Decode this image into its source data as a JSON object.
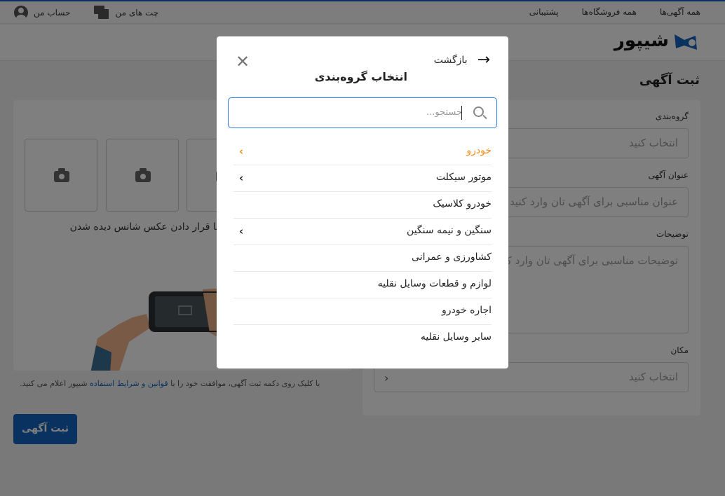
{
  "topbar": {
    "nav_right": [
      "همه آگهی‌ها",
      "همه فروشگاه‌ها",
      "پشتیبانی"
    ],
    "account_label": "حساب من",
    "chats_label": "چت های من"
  },
  "header": {
    "logo_text": "شیپور",
    "brand_color": "#1565c0"
  },
  "page": {
    "title": "ثبت آگهی"
  },
  "form": {
    "category_label": "گروه‌بندی",
    "category_placeholder": "انتخاب کنید",
    "ad_title_label": "عنوان آگهی",
    "ad_title_placeholder": "عنوان مناسبی برای آگهی تان وارد کنید",
    "description_label": "توضیحات",
    "description_placeholder": "توضیحات مناسبی برای آگهی تان وارد کنید",
    "location_label": "مکان",
    "location_placeholder": "انتخاب کنید"
  },
  "images": {
    "hint": "با قرار دادن عکس شانس دیده شدن"
  },
  "terms": {
    "before": "با کلیک روی دکمه ثبت آگهی، موافقت خود را با ",
    "link": "قوانین و شرایط استفاده",
    "after": " شیپور اعلام می کنید."
  },
  "submit_label": "ثبت آگهی",
  "modal": {
    "back_label": "بازگشت",
    "title": "انتخاب گروه‌بندی",
    "search_placeholder": "جستجو...",
    "accent_color": "#f68b1f",
    "categories": [
      {
        "label": "خودرو",
        "has_children": true,
        "active": true
      },
      {
        "label": "موتور سیکلت",
        "has_children": true,
        "active": false
      },
      {
        "label": "خودرو کلاسیک",
        "has_children": false,
        "active": false
      },
      {
        "label": "سنگین و نیمه سنگین",
        "has_children": true,
        "active": false
      },
      {
        "label": "کشاورزی و عمرانی",
        "has_children": false,
        "active": false
      },
      {
        "label": "لوازم و قطعات وسایل نقلیه",
        "has_children": false,
        "active": false
      },
      {
        "label": "اجاره خودرو",
        "has_children": false,
        "active": false
      },
      {
        "label": "سایر وسایل نقلیه",
        "has_children": false,
        "active": false
      }
    ]
  }
}
